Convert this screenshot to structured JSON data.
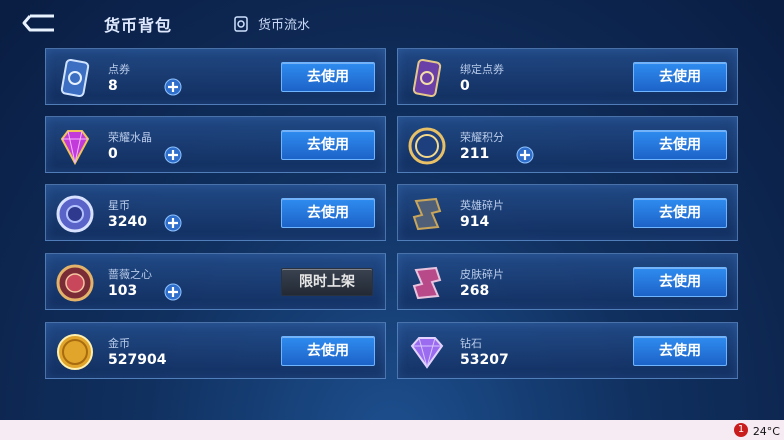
{
  "header": {
    "title": "货币背包",
    "flow_label": "货币流水"
  },
  "use_label": "去使用",
  "cards": [
    {
      "name": "点券",
      "value": "8",
      "button": "去使用",
      "icon": "ticket-icon",
      "has_plus": true
    },
    {
      "name": "绑定点券",
      "value": "0",
      "button": "去使用",
      "icon": "bound-ticket-icon",
      "has_plus": false
    },
    {
      "name": "荣耀水晶",
      "value": "0",
      "button": "去使用",
      "icon": "crystal-icon",
      "has_plus": true
    },
    {
      "name": "荣耀积分",
      "value": "211",
      "button": "去使用",
      "icon": "points-icon",
      "has_plus": true
    },
    {
      "name": "星币",
      "value": "3240",
      "button": "去使用",
      "icon": "star-coin-icon",
      "has_plus": true
    },
    {
      "name": "英雄碎片",
      "value": "914",
      "button": "去使用",
      "icon": "hero-fragment-icon",
      "has_plus": false
    },
    {
      "name": "蔷薇之心",
      "value": "103",
      "button": "限时上架",
      "icon": "rose-heart-icon",
      "has_plus": true
    },
    {
      "name": "皮肤碎片",
      "value": "268",
      "button": "去使用",
      "icon": "skin-fragment-icon",
      "has_plus": false
    },
    {
      "name": "金币",
      "value": "527904",
      "button": "去使用",
      "icon": "gold-coin-icon",
      "has_plus": false
    },
    {
      "name": "钻石",
      "value": "53207",
      "button": "去使用",
      "icon": "diamond-icon",
      "has_plus": false
    }
  ],
  "taskbar": {
    "notification_count": "1",
    "temperature": "24°C"
  }
}
